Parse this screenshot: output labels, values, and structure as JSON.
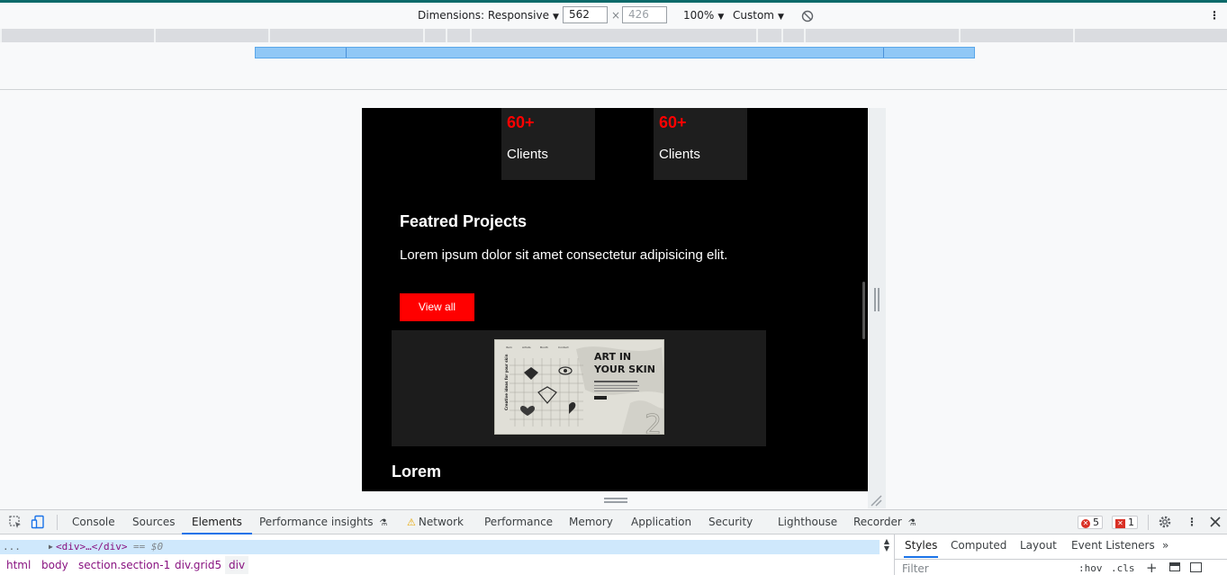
{
  "device_toolbar": {
    "dimensions_label": "Dimensions: Responsive",
    "width_value": "562",
    "times": "×",
    "height_placeholder": "426",
    "zoom": "100%",
    "throttle": "Custom"
  },
  "page": {
    "stats": [
      {
        "number": "60+",
        "label": "Clients"
      },
      {
        "number": "60+",
        "label": "Clients"
      }
    ],
    "projects_title": "Featred Projects",
    "projects_description": "Lorem ipsum dolor sit amet consectetur adipisicing elit.",
    "view_all_label": "View all",
    "project_image": {
      "heading_line1": "ART IN",
      "heading_line2": "YOUR SKIN",
      "nav": [
        "Item",
        "Artists",
        "Booth",
        "Contact"
      ],
      "side_text": "Creative ideas for your skin",
      "number": "21"
    },
    "lorem_title": "Lorem"
  },
  "devtools": {
    "tabs": [
      "Console",
      "Sources",
      "Elements",
      "Performance insights",
      "Network",
      "Performance",
      "Memory",
      "Application",
      "Security",
      "Lighthouse",
      "Recorder"
    ],
    "active_tab": "Elements",
    "error_count": "5",
    "issue_count": "1",
    "selected_node": "<div>…</div>",
    "selected_suffix": "== $0",
    "ellipsis": "...",
    "breadcrumbs": [
      "html",
      "body",
      "section.section-1",
      "div.grid5",
      "div"
    ],
    "styles_tabs": [
      "Styles",
      "Computed",
      "Layout",
      "Event Listeners"
    ],
    "more_tabs": "»",
    "filter_placeholder": "Filter",
    "hov_label": ":hov",
    "cls_label": ".cls"
  },
  "colors": {
    "accent": "#ff0000",
    "devtools_active": "#1a73e8",
    "error": "#d93025"
  }
}
